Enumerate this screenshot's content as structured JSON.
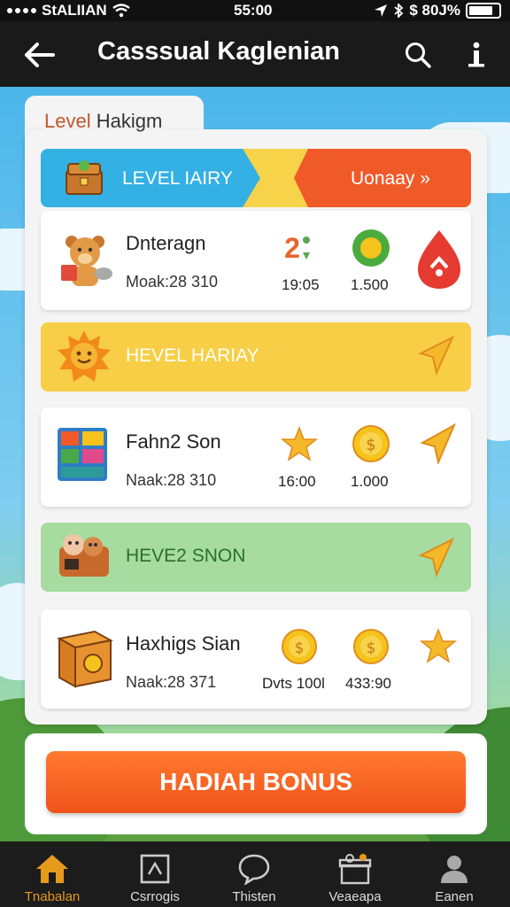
{
  "status_bar": {
    "carrier": "StALIIAN",
    "time": "55:00",
    "battery": "$ 80J%"
  },
  "app_bar": {
    "title": "Casssual Kaglenian"
  },
  "card": {
    "tab_label_a": "Level",
    "tab_label_b": " Hakigm"
  },
  "top_banner": {
    "left_label": "LEVEL IAIRY",
    "right_label": "Uonaay »"
  },
  "rows": [
    {
      "title": "Dnteragn",
      "subtitle": "Moak:28 310",
      "val_1": "19:05",
      "val_2": "1.500",
      "badge": "2"
    },
    {
      "title": "Fahn2 Son",
      "subtitle": "Naak:28 310",
      "val_1": "16:00",
      "val_2": "1.000"
    },
    {
      "title": "Haxhigs Sian",
      "subtitle": "Naak:28 371",
      "val_1": "Dvts 100l",
      "val_2": "433:90"
    }
  ],
  "level_banners": [
    {
      "label": "HEVEL HARIAY",
      "color": "#f7ce45",
      "text_color": "#ffffff"
    },
    {
      "label": "HEVE2 SNON",
      "color": "#a6dca0",
      "text_color": "#2d6e2b"
    }
  ],
  "bonus": {
    "label": "HADIAH BONUS"
  },
  "bottom_nav": [
    {
      "label": "Tnabalan",
      "icon": "home-icon",
      "active": true
    },
    {
      "label": "Csrrogis",
      "icon": "game-icon",
      "active": false
    },
    {
      "label": "Thisten",
      "icon": "chat-icon",
      "active": false
    },
    {
      "label": "Veaeapa",
      "icon": "gift-icon",
      "active": false
    },
    {
      "label": "Eanen",
      "icon": "profile-icon",
      "active": false
    }
  ],
  "colors": {
    "accent_orange": "#f05a28",
    "banner_blue": "#33b0e4",
    "banner_yellow": "#f7ce45",
    "banner_green": "#a6dca0"
  }
}
